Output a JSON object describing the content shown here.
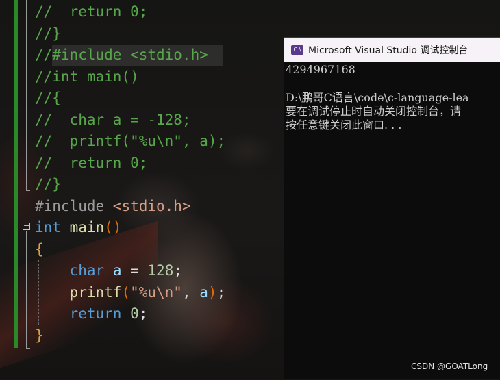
{
  "editor": {
    "lines": [
      {
        "segments": [
          {
            "cls": "cmt",
            "text": "//  return 0;"
          }
        ]
      },
      {
        "segments": [
          {
            "cls": "cmt",
            "text": "//}"
          }
        ]
      },
      {
        "segments": [
          {
            "cls": "cmt",
            "text": "//#include <stdio.h>"
          }
        ]
      },
      {
        "segments": [
          {
            "cls": "cmt",
            "text": "//int main()"
          }
        ]
      },
      {
        "segments": [
          {
            "cls": "cmt",
            "text": "//{"
          }
        ]
      },
      {
        "segments": [
          {
            "cls": "cmt",
            "text": "//  char a = -128;"
          }
        ]
      },
      {
        "segments": [
          {
            "cls": "cmt",
            "text": "//  printf(\"%u\\n\", a);"
          }
        ]
      },
      {
        "segments": [
          {
            "cls": "cmt",
            "text": "//  return 0;"
          }
        ]
      },
      {
        "segments": [
          {
            "cls": "cmt",
            "text": "//}"
          }
        ]
      },
      {
        "segments": [
          {
            "cls": "pp",
            "text": "#include "
          },
          {
            "cls": "hdr",
            "text": "<stdio.h>"
          }
        ]
      },
      {
        "segments": [
          {
            "cls": "kw",
            "text": "int"
          },
          {
            "cls": "pn",
            "text": " "
          },
          {
            "cls": "fn",
            "text": "main"
          },
          {
            "cls": "paren",
            "text": "()"
          }
        ]
      },
      {
        "segments": [
          {
            "cls": "brace",
            "text": "{"
          }
        ]
      },
      {
        "segments": [
          {
            "cls": "pn",
            "text": "    "
          },
          {
            "cls": "kw",
            "text": "char"
          },
          {
            "cls": "pn",
            "text": " "
          },
          {
            "cls": "id",
            "text": "a"
          },
          {
            "cls": "pn",
            "text": " = "
          },
          {
            "cls": "num",
            "text": "128"
          },
          {
            "cls": "pn",
            "text": ";"
          }
        ]
      },
      {
        "segments": [
          {
            "cls": "pn",
            "text": "    "
          },
          {
            "cls": "fn",
            "text": "printf"
          },
          {
            "cls": "paren",
            "text": "("
          },
          {
            "cls": "str",
            "text": "\"%u\\n\""
          },
          {
            "cls": "pn",
            "text": ", "
          },
          {
            "cls": "id",
            "text": "a"
          },
          {
            "cls": "paren",
            "text": ")"
          },
          {
            "cls": "pn",
            "text": ";"
          }
        ]
      },
      {
        "segments": [
          {
            "cls": "pn",
            "text": "    "
          },
          {
            "cls": "kw",
            "text": "return"
          },
          {
            "cls": "pn",
            "text": " "
          },
          {
            "cls": "num",
            "text": "0"
          },
          {
            "cls": "pn",
            "text": ";"
          }
        ]
      },
      {
        "segments": [
          {
            "cls": "brace",
            "text": "}"
          }
        ]
      }
    ],
    "fold_glyph": "−"
  },
  "console": {
    "icon_text": "C:\\",
    "title": "Microsoft Visual Studio 调试控制台",
    "output": [
      "4294967168",
      "",
      "D:\\鹏哥C语言\\code\\c-language-lea",
      "要在调试停止时自动关闭控制台，请",
      "按任意键关闭此窗口. . ."
    ]
  },
  "watermark": "CSDN @GOATLong",
  "colors": {
    "comment": "#57a64a",
    "keyword": "#569cd6",
    "function": "#dcdcaa",
    "string": "#d69d85",
    "number": "#b5cea8",
    "margin_bar": "#2a8a2a",
    "console_bg": "#0c0c0c",
    "titlebar_bg": "#f7f2f7"
  }
}
